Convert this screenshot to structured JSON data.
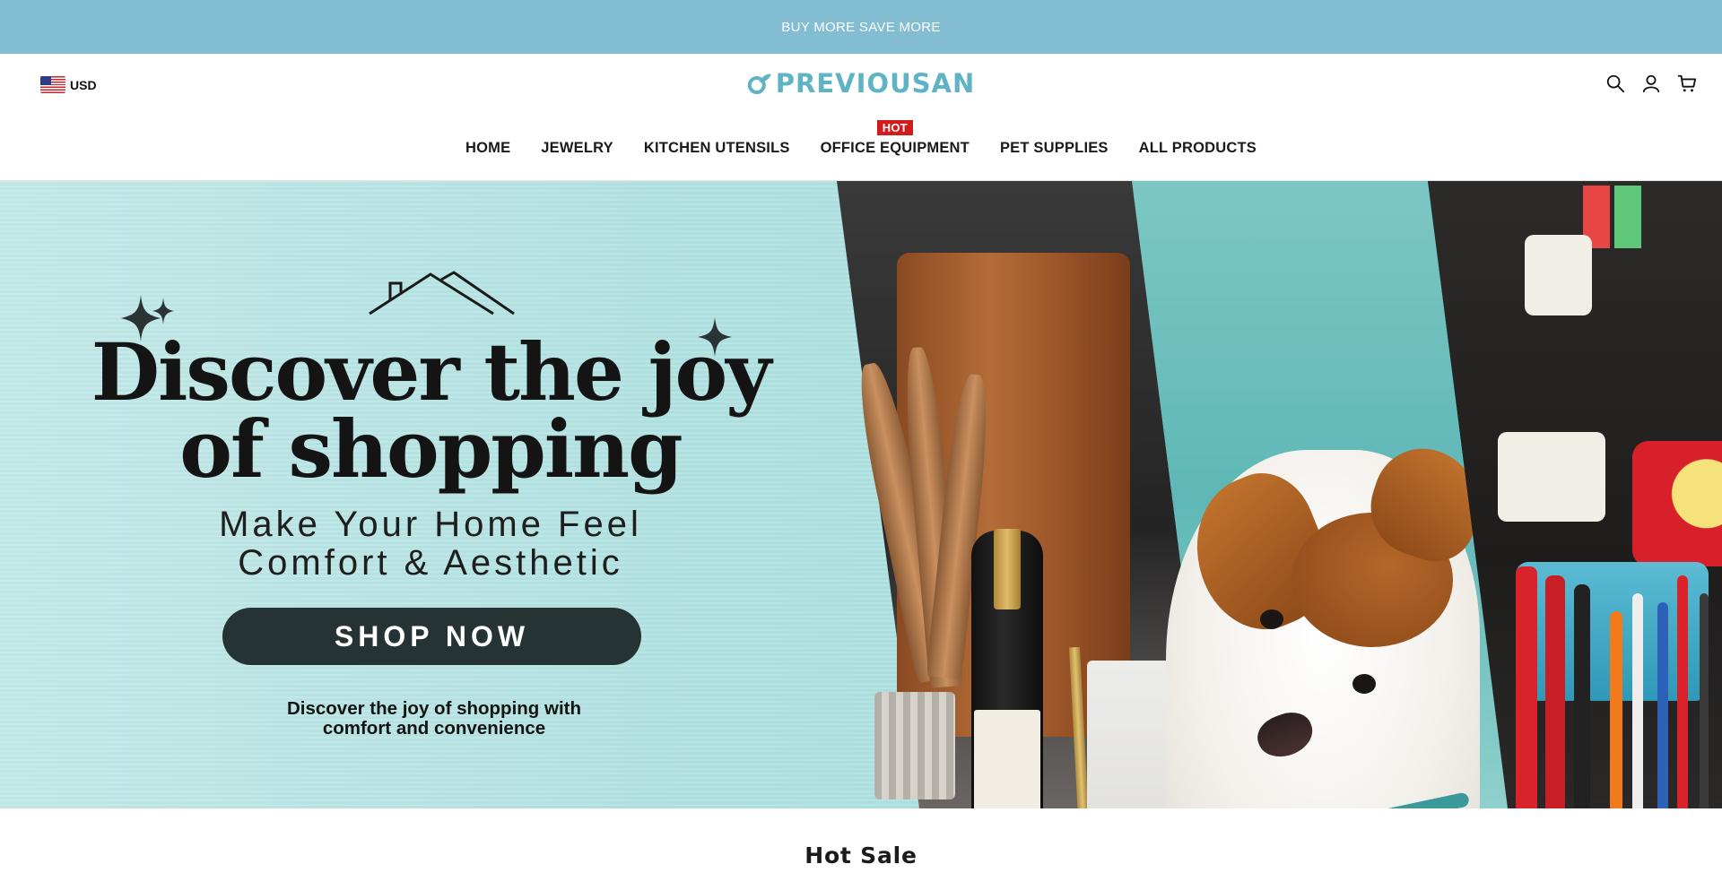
{
  "announcement": {
    "text": "BUY MORE SAVE MORE"
  },
  "header": {
    "currency": {
      "code": "USD",
      "flag_icon": "us-flag-icon"
    },
    "logo": {
      "text": "PREVIOUSAN",
      "color": "#5eb4c4"
    },
    "icons": [
      "search-icon",
      "account-icon",
      "cart-icon"
    ]
  },
  "nav": {
    "items": [
      {
        "label": "HOME"
      },
      {
        "label": "JEWELRY"
      },
      {
        "label": "KITCHEN UTENSILS"
      },
      {
        "label": "OFFICE EQUIPMENT",
        "badge": "HOT"
      },
      {
        "label": "PET SUPPLIES"
      },
      {
        "label": "ALL PRODUCTS"
      }
    ],
    "badge_color": "#d01c1c"
  },
  "hero": {
    "title_line1": "Discover the joy",
    "title_line2": "of shopping",
    "subtitle_line1": "Make Your Home Feel",
    "subtitle_line2": "Comfort & Aesthetic",
    "cta_label": "SHOP NOW",
    "note_line1": "Discover the joy of shopping with",
    "note_line2": "comfort and convenience",
    "colors": {
      "background": "#b2e2e2",
      "cta": "#253335"
    }
  },
  "sections": {
    "hot_sale_title": "Hot Sale"
  },
  "colors": {
    "announcement_bar": "#83bdd1"
  }
}
